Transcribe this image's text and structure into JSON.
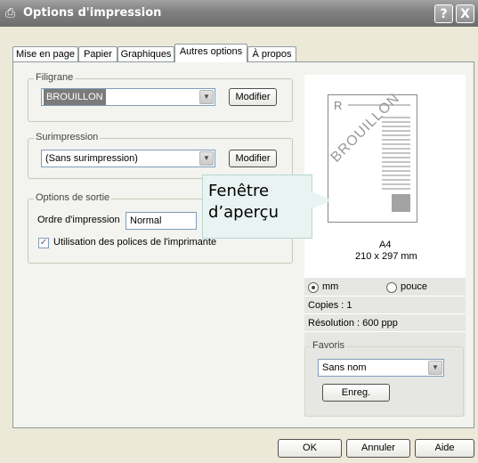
{
  "window": {
    "title": "Options d'impression",
    "help_btn": "?",
    "close_btn": "X"
  },
  "tabs": [
    {
      "label": "Mise en page"
    },
    {
      "label": "Papier"
    },
    {
      "label": "Graphiques"
    },
    {
      "label": "Autres options"
    },
    {
      "label": "À propos"
    }
  ],
  "filigrane": {
    "label": "Filigrane",
    "value": "BROUILLON",
    "modify": "Modifier"
  },
  "surimpression": {
    "label": "Surimpression",
    "value": "(Sans surimpression)",
    "modify": "Modifier"
  },
  "output": {
    "label": "Options de sortie",
    "order_label": "Ordre d'impression",
    "order_value": "Normal",
    "fonts_checkbox": "Utilisation des polices de l'imprimante",
    "fonts_checked": true
  },
  "preview": {
    "paper_letter": "R",
    "watermark": "BROUILLON",
    "size_name": "A4",
    "size_dims": "210 x 297 mm",
    "unit_mm": "mm",
    "unit_inch": "pouce",
    "unit_selected": "mm",
    "copies": "Copies : 1",
    "resolution": "Résolution : 600 ppp"
  },
  "favoris": {
    "label": "Favoris",
    "value": "Sans nom",
    "save": "Enreg."
  },
  "callout": {
    "line1": "Fenêtre",
    "line2": "d’aperçu"
  },
  "footer": {
    "ok": "OK",
    "cancel": "Annuler",
    "help": "Aide"
  }
}
